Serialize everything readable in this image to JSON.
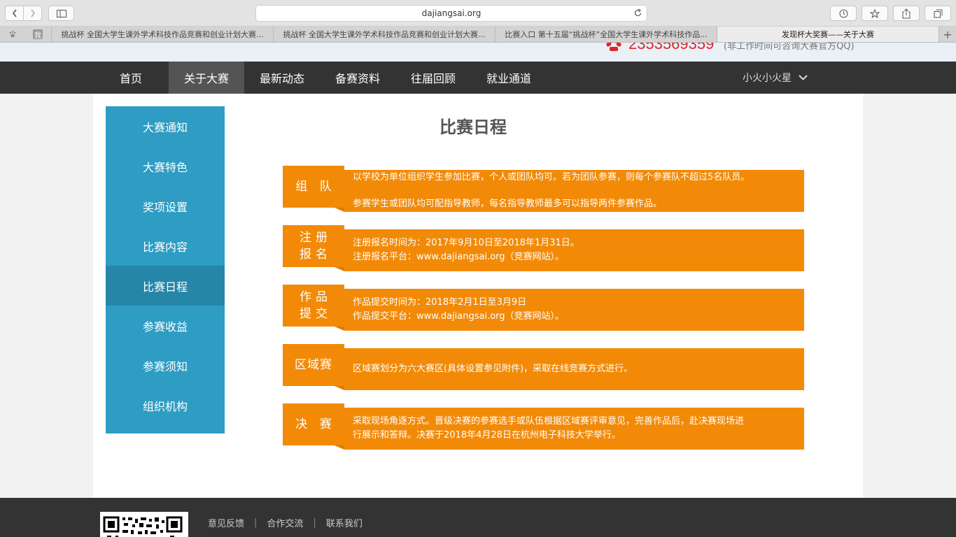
{
  "browser": {
    "url": "dajiangsai.org",
    "tabs": [
      "挑战杯 全国大学生课外学术科技作品竞赛和创业计划大赛...",
      "挑战杯 全国大学生课外学术科技作品竞赛和创业计划大赛...",
      "比赛入口 第十五届“挑战杯”全国大学生课外学术科技作品...",
      "发现杯大奖赛——关于大赛"
    ],
    "pinned_tab_label": "我",
    "new_tab": "+"
  },
  "header": {
    "phone": "2353569359",
    "phone_note": "(非工作时间可咨询大赛官方QQ)"
  },
  "nav": {
    "items": [
      "首页",
      "关于大赛",
      "最新动态",
      "备赛资料",
      "往届回顾",
      "就业通道"
    ],
    "active_index": 1,
    "user": "小火小火星"
  },
  "sidebar": {
    "items": [
      "大赛通知",
      "大赛特色",
      "奖项设置",
      "比赛内容",
      "比赛日程",
      "参赛收益",
      "参赛须知",
      "组织机构"
    ],
    "active_index": 4
  },
  "main": {
    "title": "比赛日程",
    "schedule": [
      {
        "label_lines": [
          "组 队"
        ],
        "lines": [
          "以学校为单位组织学生参加比赛，个人或团队均可。若为团队参赛，则每个参赛队不超过5名队员。",
          "参赛学生或团队均可配指导教师，每名指导教师最多可以指导两件参赛作品。"
        ]
      },
      {
        "label_lines": [
          "注册",
          "报名"
        ],
        "lines": [
          "注册报名时间为：2017年9月10日至2018年1月31日。",
          "注册报名平台：www.dajiangsai.org（竞赛网站）。"
        ]
      },
      {
        "label_lines": [
          "作品",
          "提交"
        ],
        "lines": [
          "作品提交时间为：2018年2月1日至3月9日",
          "作品提交平台：www.dajiangsai.org（竞赛网站）。"
        ]
      },
      {
        "label_lines": [
          "区域赛"
        ],
        "lines": [
          "区域赛划分为六大赛区(具体设置参见附件)，采取在线竞赛方式进行。"
        ]
      },
      {
        "label_lines": [
          "决 赛"
        ],
        "lines": [
          "采取现场角逐方式。晋级决赛的参赛选手或队伍根据区域赛评审意见，完善作品后，赴决赛现场进",
          "行展示和答辩。决赛于2018年4月28日在杭州电子科技大学举行。"
        ]
      }
    ]
  },
  "footer": {
    "links": [
      "意见反馈",
      "合作交流",
      "联系我们"
    ],
    "separator": "|"
  },
  "colors": {
    "accent_orange": "#f28a07",
    "sidebar_blue": "#2e9cc3",
    "nav_dark": "#333333",
    "phone_red": "#e0242a"
  }
}
